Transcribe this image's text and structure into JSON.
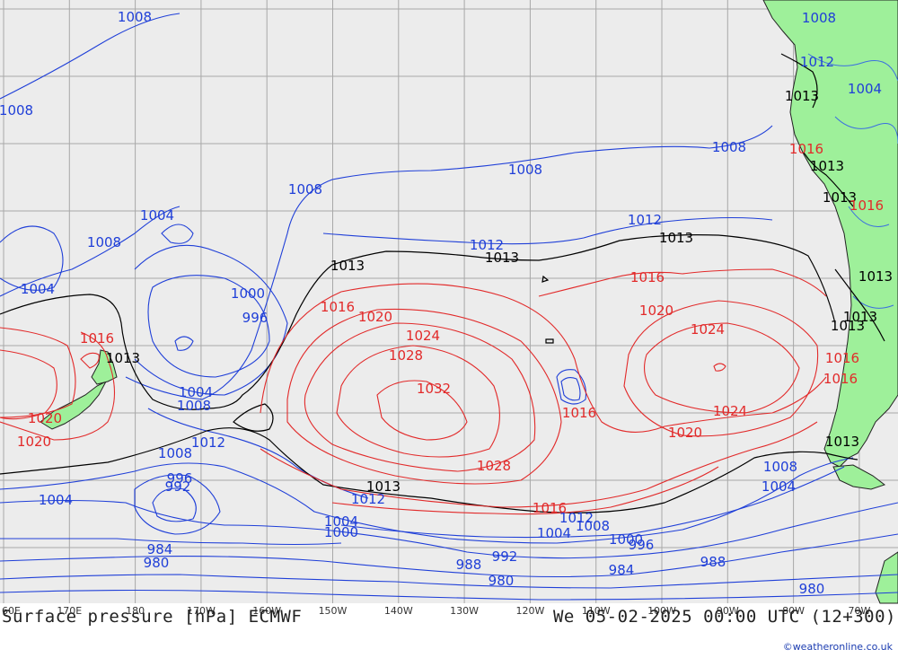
{
  "title": "Surface pressure [hPa] ECMWF",
  "datetime": "We 05-02-2025 00:00 UTC (12+300)",
  "credit": "©weatheronline.co.uk",
  "colors": {
    "ocean": "#ececec",
    "land": "#9ef09a",
    "grid": "#a8a8a8",
    "low": "#1f3fd8",
    "normal": "#000000",
    "high": "#e22a2a",
    "river": "#3b6fe0"
  },
  "longitudes": [
    "60E",
    "170E",
    "180",
    "170W",
    "160W",
    "150W",
    "140W",
    "130W",
    "120W",
    "110W",
    "100W",
    "90W",
    "80W",
    "70W"
  ],
  "isobar_labels": [
    {
      "text": "1008",
      "kind": "low"
    },
    {
      "text": "1008",
      "kind": "low"
    },
    {
      "text": "1008",
      "kind": "low"
    },
    {
      "text": "1008",
      "kind": "low"
    },
    {
      "text": "1008",
      "kind": "low"
    },
    {
      "text": "1008",
      "kind": "low"
    },
    {
      "text": "1008",
      "kind": "low"
    },
    {
      "text": "1004",
      "kind": "low"
    },
    {
      "text": "1004",
      "kind": "low"
    },
    {
      "text": "1000",
      "kind": "low"
    },
    {
      "text": "996",
      "kind": "low"
    },
    {
      "text": "1004",
      "kind": "low"
    },
    {
      "text": "1008",
      "kind": "low"
    },
    {
      "text": "1012",
      "kind": "low"
    },
    {
      "text": "1008",
      "kind": "low"
    },
    {
      "text": "996",
      "kind": "low"
    },
    {
      "text": "992",
      "kind": "low"
    },
    {
      "text": "1004",
      "kind": "low"
    },
    {
      "text": "1012",
      "kind": "low"
    },
    {
      "text": "1012",
      "kind": "low"
    },
    {
      "text": "1012",
      "kind": "low"
    },
    {
      "text": "1004",
      "kind": "low"
    },
    {
      "text": "1000",
      "kind": "low"
    },
    {
      "text": "984",
      "kind": "low"
    },
    {
      "text": "980",
      "kind": "low"
    },
    {
      "text": "988",
      "kind": "low"
    },
    {
      "text": "992",
      "kind": "low"
    },
    {
      "text": "980",
      "kind": "low"
    },
    {
      "text": "1004",
      "kind": "low"
    },
    {
      "text": "1008",
      "kind": "low"
    },
    {
      "text": "1000",
      "kind": "low"
    },
    {
      "text": "996",
      "kind": "low"
    },
    {
      "text": "984",
      "kind": "low"
    },
    {
      "text": "988",
      "kind": "low"
    },
    {
      "text": "1008",
      "kind": "low"
    },
    {
      "text": "1004",
      "kind": "low"
    },
    {
      "text": "980",
      "kind": "low"
    },
    {
      "text": "1012",
      "kind": "low"
    },
    {
      "text": "1012",
      "kind": "low"
    },
    {
      "text": "1012",
      "kind": "low"
    },
    {
      "text": "1012",
      "kind": "low"
    },
    {
      "text": "1004",
      "kind": "low"
    },
    {
      "text": "1013",
      "kind": "normal"
    },
    {
      "text": "1013",
      "kind": "normal"
    },
    {
      "text": "1013",
      "kind": "normal"
    },
    {
      "text": "1013",
      "kind": "normal"
    },
    {
      "text": "1013",
      "kind": "normal"
    },
    {
      "text": "1013",
      "kind": "normal"
    },
    {
      "text": "1013",
      "kind": "normal"
    },
    {
      "text": "1013",
      "kind": "normal"
    },
    {
      "text": "1013",
      "kind": "normal"
    },
    {
      "text": "1013",
      "kind": "normal"
    },
    {
      "text": "1013",
      "kind": "normal"
    },
    {
      "text": "1013",
      "kind": "normal"
    },
    {
      "text": "1016",
      "kind": "high"
    },
    {
      "text": "1020",
      "kind": "high"
    },
    {
      "text": "1024",
      "kind": "high"
    },
    {
      "text": "1028",
      "kind": "high"
    },
    {
      "text": "1032",
      "kind": "high"
    },
    {
      "text": "1028",
      "kind": "high"
    },
    {
      "text": "1016",
      "kind": "high"
    },
    {
      "text": "1016",
      "kind": "high"
    },
    {
      "text": "1020",
      "kind": "high"
    },
    {
      "text": "1024",
      "kind": "high"
    },
    {
      "text": "1024",
      "kind": "high"
    },
    {
      "text": "1020",
      "kind": "high"
    },
    {
      "text": "1016",
      "kind": "high"
    },
    {
      "text": "1016",
      "kind": "high"
    },
    {
      "text": "1020",
      "kind": "high"
    },
    {
      "text": "1020",
      "kind": "high"
    },
    {
      "text": "1016",
      "kind": "high"
    },
    {
      "text": "1016",
      "kind": "high"
    },
    {
      "text": "1016",
      "kind": "high"
    },
    {
      "text": "1016",
      "kind": "high"
    },
    {
      "text": "1020",
      "kind": "high"
    }
  ]
}
